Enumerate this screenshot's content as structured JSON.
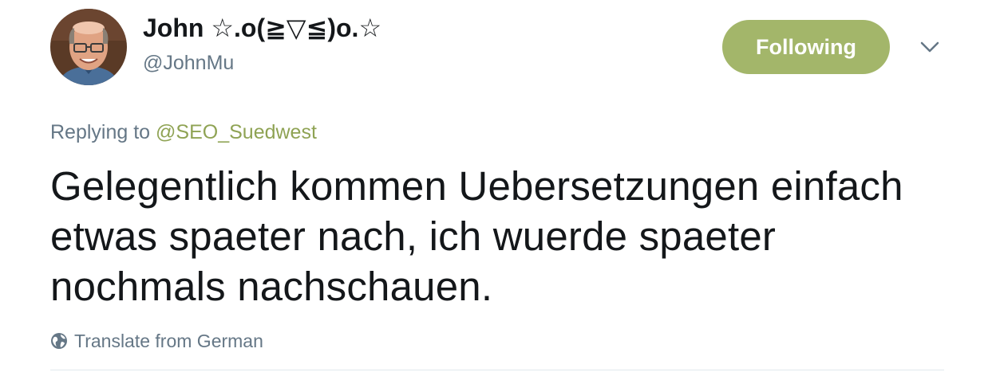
{
  "author": {
    "display_name": "John ☆.o(≧▽≦)o.☆",
    "handle": "@JohnMu"
  },
  "follow_button": {
    "label": "Following"
  },
  "reply": {
    "prefix": "Replying to ",
    "target": "@SEO_Suedwest"
  },
  "tweet": {
    "text": "Gelegentlich kommen Uebersetzungen einfach etwas spaeter nach, ich wuerde spaeter nochmals nachschauen."
  },
  "translate": {
    "label": "Translate from German"
  },
  "colors": {
    "accent": "#a3b66a",
    "link": "#8fa354",
    "muted": "#657786",
    "text": "#14171a"
  },
  "icons": {
    "menu": "chevron-down-icon",
    "translate": "globe-icon"
  }
}
